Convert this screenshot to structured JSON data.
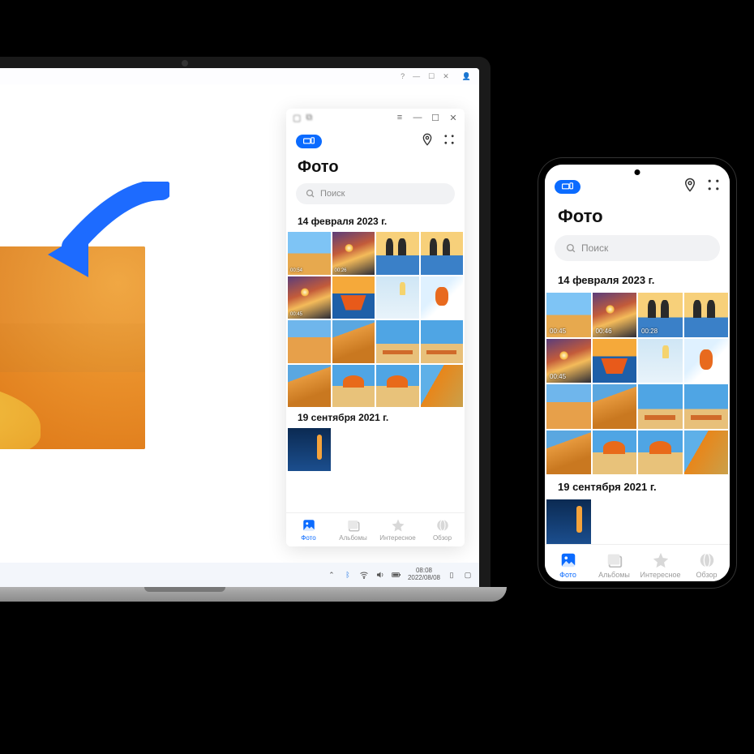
{
  "gallery": {
    "title": "Фото",
    "search_placeholder": "Поиск",
    "date1": "14 февраля 2023 г.",
    "date2": "19 сентября 2021 г.",
    "durations": {
      "d1": "00:54",
      "d2": "00:26",
      "d3": "00:45",
      "p1": "00:45",
      "p2": "00:46",
      "p3": "00:28",
      "p4": "00:45"
    },
    "nav": {
      "photos": "Фото",
      "albums": "Альбомы",
      "interesting": "Интересное",
      "overview": "Обзор"
    }
  },
  "taskbar": {
    "time": "08:08",
    "date": "2022/08/08"
  },
  "colors": {
    "accent": "#0b6bff"
  }
}
